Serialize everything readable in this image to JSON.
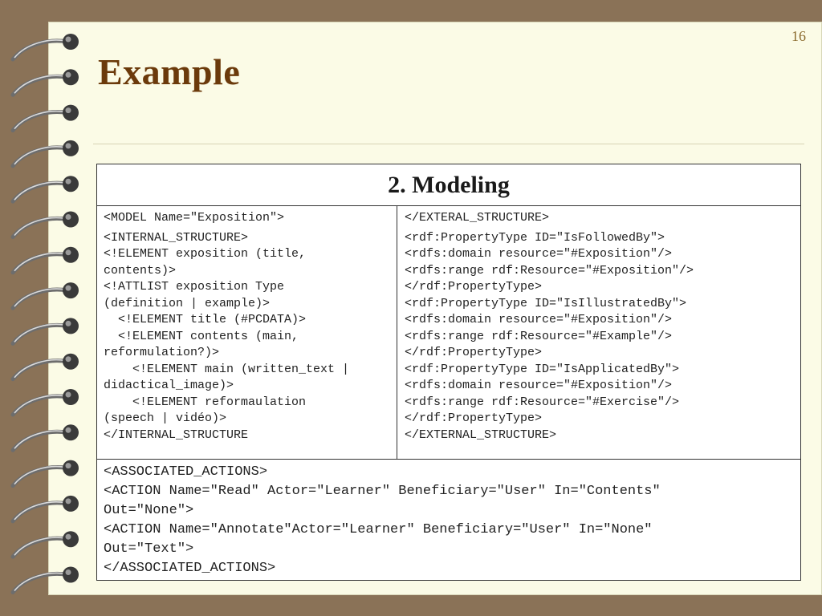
{
  "slide": {
    "page_number": "16",
    "title": "Example"
  },
  "table": {
    "header": "2. Modeling",
    "left_top_line": "<MODEL Name=\"Exposition\">",
    "left_lines": [
      "<INTERNAL_STRUCTURE>",
      "<!ELEMENT exposition (title,",
      "contents)>",
      "<!ATTLIST exposition Type",
      "(definition | example)>",
      "  <!ELEMENT title (#PCDATA)>",
      "  <!ELEMENT contents (main,",
      "reformulation?)>",
      "    <!ELEMENT main (written_text |",
      "didactical_image)>",
      "    <!ELEMENT reformaulation",
      "(speech | vidéo)>",
      "</INTERNAL_STRUCTURE"
    ],
    "right_top_line": "</EXTERAL_STRUCTURE>",
    "right_lines": [
      "<rdf:PropertyType ID=\"IsFollowedBy\">",
      "<rdfs:domain resource=\"#Exposition\"/>",
      "<rdfs:range rdf:Resource=\"#Exposition\"/>",
      "</rdf:PropertyType>",
      "<rdf:PropertyType ID=\"IsIllustratedBy\">",
      "<rdfs:domain resource=\"#Exposition\"/>",
      "<rdfs:range rdf:Resource=\"#Example\"/>",
      "</rdf:PropertyType>",
      "<rdf:PropertyType ID=\"IsApplicatedBy\">",
      "<rdfs:domain resource=\"#Exposition\"/>",
      "<rdfs:range rdf:Resource=\"#Exercise\"/>",
      "</rdf:PropertyType>",
      "</EXTERNAL_STRUCTURE>"
    ],
    "bottom_lines": [
      "<ASSOCIATED_ACTIONS>",
      "<ACTION Name=\"Read\" Actor=\"Learner\" Beneficiary=\"User\" In=\"Contents\"",
      "Out=\"None\">",
      "<ACTION Name=\"Annotate\"Actor=\"Learner\" Beneficiary=\"User\" In=\"None\"",
      "Out=\"Text\">",
      "</ASSOCIATED_ACTIONS>"
    ]
  },
  "colors": {
    "background": "#8a7257",
    "paper": "#fbfbe6",
    "title": "#6b3a0b"
  },
  "icons": [
    "spiral-binding-ring-icon"
  ]
}
